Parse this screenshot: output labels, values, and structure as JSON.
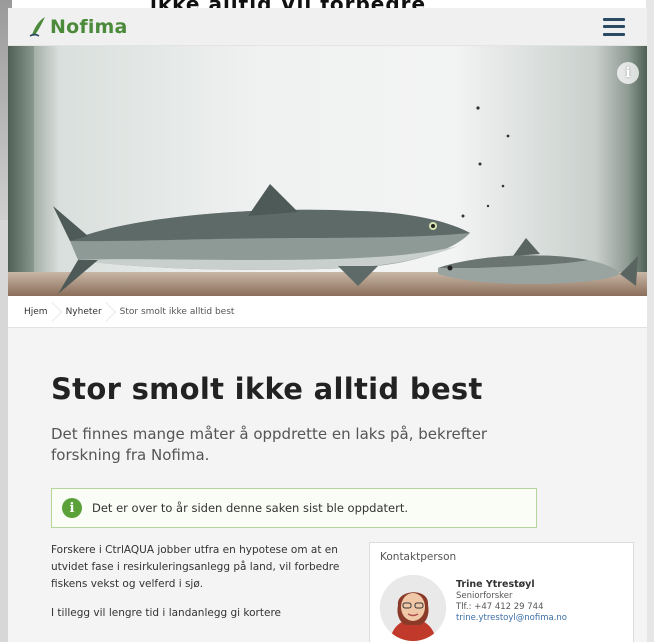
{
  "background": {
    "partial_text": "ikke alltid                  Vil forbedre"
  },
  "header": {
    "logo_text": "Nofima",
    "menu_icon": "hamburger-menu-icon",
    "brand_color": "#4a8a3a"
  },
  "hero": {
    "info_label": "i",
    "alt": "salmon-photo"
  },
  "breadcrumb": {
    "items": [
      "Hjem",
      "Nyheter",
      "Stor smolt ikke alltid best"
    ]
  },
  "article": {
    "title": "Stor smolt ikke alltid best",
    "lead": "Det finnes mange måter å oppdrette en laks på, bekrefter forskning fra Nofima.",
    "notice": "Det er over to år siden denne saken sist ble oppdatert.",
    "notice_icon": "info-icon",
    "paragraphs": [
      "Forskere i CtrlAQUA jobber utfra en hypotese om at en utvidet fase i resirkuleringsanlegg på land, vil forbedre fiskens vekst og velferd i sjø.",
      "I tillegg vil lengre tid i landanlegg gi kortere"
    ]
  },
  "contact": {
    "heading": "Kontaktperson",
    "name": "Trine Ytrestøyl",
    "role": "Seniorforsker",
    "phone": "Tlf.: +47 412 29 744",
    "email": "trine.ytrestoyl@nofima.no"
  }
}
